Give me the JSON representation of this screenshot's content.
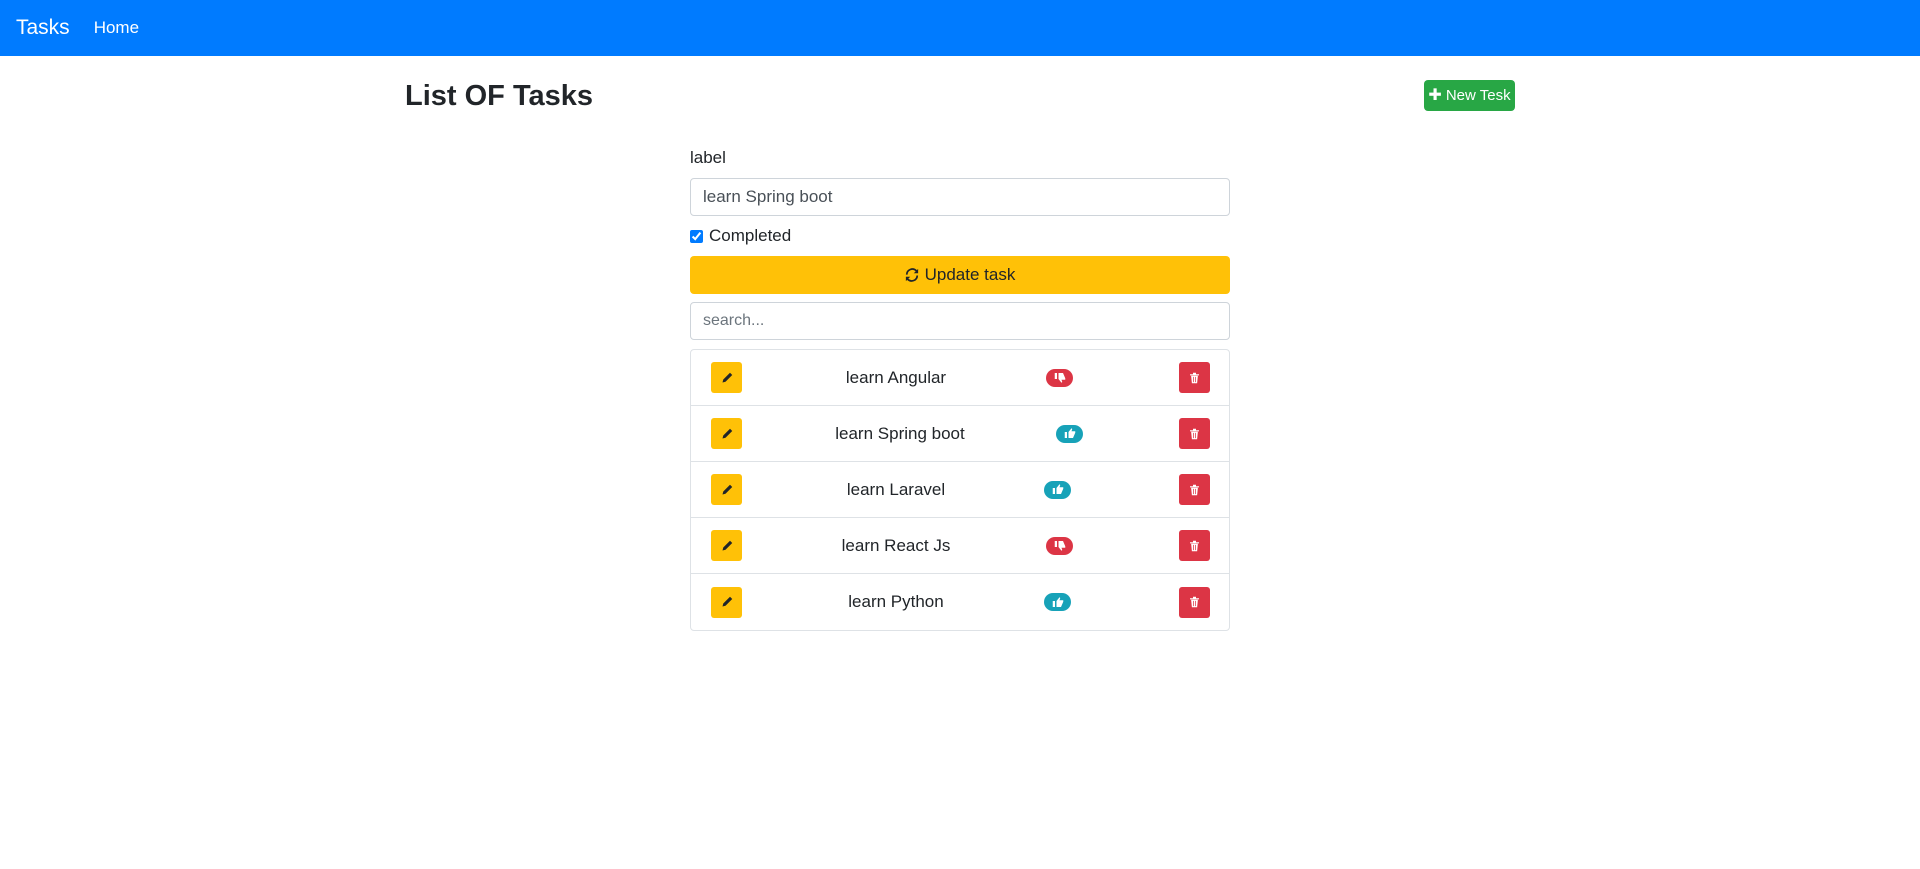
{
  "navbar": {
    "brand": "Tasks",
    "home_link": "Home"
  },
  "page": {
    "title": "List OF Tasks",
    "new_button": "New Tesk"
  },
  "form": {
    "label": "label",
    "label_value": "learn Spring boot",
    "completed_label": "Completed",
    "completed_checked": true,
    "update_button": "Update task",
    "search_placeholder": "search..."
  },
  "colors": {
    "primary": "#007bff",
    "success": "#28a745",
    "warning": "#ffc107",
    "danger": "#dc3545",
    "info": "#17a2b8"
  },
  "tasks": [
    {
      "label": "learn Angular",
      "completed": false,
      "status_icon": "thumbs-down-icon"
    },
    {
      "label": "learn Spring boot",
      "completed": true,
      "status_icon": "thumbs-up-icon"
    },
    {
      "label": "learn Laravel",
      "completed": true,
      "status_icon": "thumbs-up-icon"
    },
    {
      "label": "learn React Js",
      "completed": false,
      "status_icon": "thumbs-down-icon"
    },
    {
      "label": "learn Python",
      "completed": true,
      "status_icon": "thumbs-up-icon"
    }
  ]
}
